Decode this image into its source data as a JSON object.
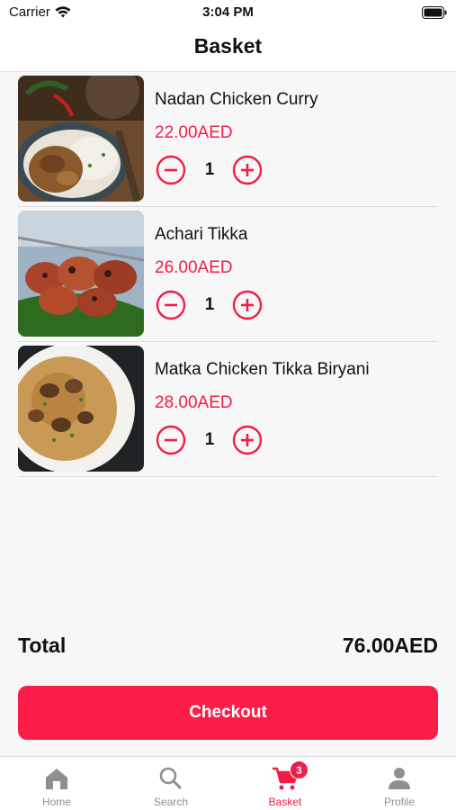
{
  "status_bar": {
    "carrier": "Carrier",
    "time": "3:04 PM"
  },
  "header": {
    "title": "Basket"
  },
  "basket": {
    "items": [
      {
        "name": "Nadan Chicken Curry",
        "price": "22.00AED",
        "quantity": "1",
        "image": "chicken-curry-with-rice-image"
      },
      {
        "name": "Achari Tikka",
        "price": "26.00AED",
        "quantity": "1",
        "image": "grilled-tikka-skewers-image"
      },
      {
        "name": "Matka Chicken Tikka Biryani",
        "price": "28.00AED",
        "quantity": "1",
        "image": "biryani-plate-image"
      }
    ]
  },
  "summary": {
    "total_label": "Total",
    "total_value": "76.00AED"
  },
  "checkout": {
    "label": "Checkout"
  },
  "tabs": [
    {
      "label": "Home",
      "icon": "home-icon"
    },
    {
      "label": "Search",
      "icon": "search-icon"
    },
    {
      "label": "Basket",
      "icon": "cart-icon",
      "badge": "3",
      "active": true
    },
    {
      "label": "Profile",
      "icon": "person-icon"
    }
  ],
  "colors": {
    "accent": "#f01d48",
    "button": "#fb1c48",
    "background": "#f7f7f7",
    "inactive_tab": "#8f8f8f"
  }
}
